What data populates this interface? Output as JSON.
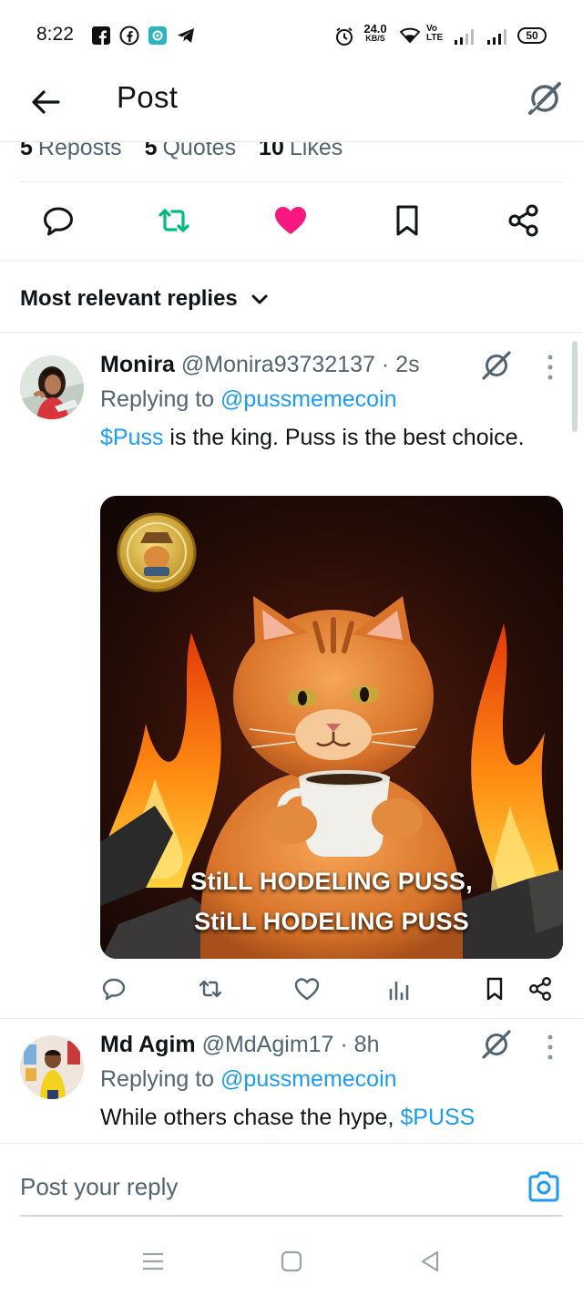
{
  "status_bar": {
    "time": "8:22",
    "speed_value": "24.0",
    "speed_unit": "KB/S",
    "volte": "Vo",
    "lte": "LTE",
    "battery": "50"
  },
  "header": {
    "title": "Post"
  },
  "stats": {
    "reposts_count": "5",
    "reposts_label": "Reposts",
    "quotes_count": "5",
    "quotes_label": "Quotes",
    "likes_count": "10",
    "likes_label": "Likes"
  },
  "filter": {
    "label": "Most relevant replies"
  },
  "replies": [
    {
      "name": "Monira",
      "handle": "@Monira93732137",
      "time": "· 2s",
      "replying_prefix": "Replying to",
      "replying_to": "@pussmemecoin",
      "text_link": "$Puss",
      "text_rest": " is the king. Puss is the best choice.",
      "media_caption_line1": "StiLL HODELING PUSS,",
      "media_caption_line2": "StiLL HODELING PUSS"
    },
    {
      "name": "Md Agim",
      "handle": "@MdAgim17",
      "time": "· 8h",
      "replying_prefix": "Replying to",
      "replying_to": "@pussmemecoin",
      "text_plain": "While others chase the hype, ",
      "text_link": "$PUSS"
    }
  ],
  "composer": {
    "placeholder": "Post your reply"
  },
  "colors": {
    "accent": "#1d9bf0",
    "like": "#f91880",
    "repost": "#00ba7c",
    "text": "#0f1419",
    "secondary": "#536471"
  },
  "icons": {
    "back": "arrow-left-icon",
    "grok": "grok-icon",
    "reply": "speech-bubble-icon",
    "repost": "repost-icon",
    "like": "heart-icon",
    "bookmark": "bookmark-icon",
    "share": "share-icon",
    "views": "bar-chart-icon",
    "more": "vertical-ellipsis-icon",
    "camera": "camera-icon"
  }
}
